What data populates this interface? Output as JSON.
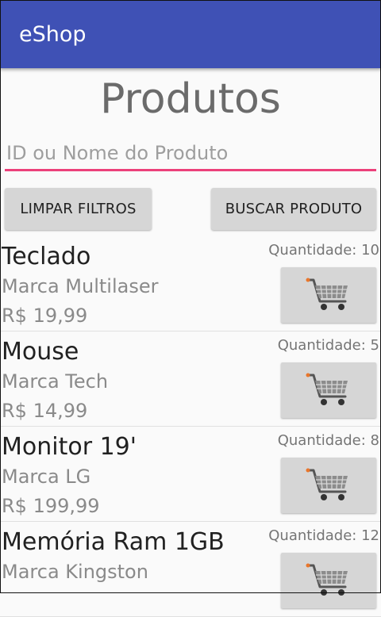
{
  "app": {
    "title": "eShop",
    "accent_color": "#3f51b5",
    "input_underline_color": "#ec407a"
  },
  "page": {
    "title": "Produtos"
  },
  "search": {
    "value": "",
    "placeholder": "ID ou Nome do Produto"
  },
  "buttons": {
    "clear_label": "LIMPAR FILTROS",
    "search_label": "BUSCAR PRODUTO"
  },
  "products": [
    {
      "name": "Teclado",
      "brand": "Marca Multilaser",
      "price": "R$ 19,99",
      "quantity": "Quantidade: 10",
      "cart_icon": "shopping-cart-icon"
    },
    {
      "name": "Mouse",
      "brand": "Marca Tech",
      "price": "R$ 14,99",
      "quantity": "Quantidade: 5",
      "cart_icon": "shopping-cart-icon"
    },
    {
      "name": "Monitor 19'",
      "brand": "Marca LG",
      "price": "R$ 199,99",
      "quantity": "Quantidade: 8",
      "cart_icon": "shopping-cart-icon"
    },
    {
      "name": "Memória Ram 1GB",
      "brand": "Marca Kingston",
      "price": "",
      "quantity": "Quantidade: 12",
      "cart_icon": "shopping-cart-icon"
    }
  ]
}
